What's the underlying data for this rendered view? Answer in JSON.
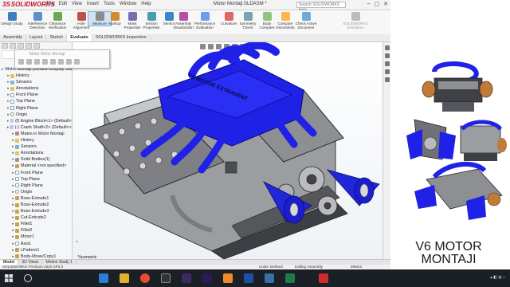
{
  "app": {
    "logo_text": "SOLIDWORKS",
    "menu": [
      "File",
      "Edit",
      "View",
      "Insert",
      "Tools",
      "Window",
      "Help"
    ],
    "document_title": "Motor Montaji.SLDASM *",
    "search_placeholder": "Search SOLIDWORKS Help"
  },
  "commands": [
    {
      "label": "Design Study",
      "color": "#3b7dc0"
    },
    {
      "label": "Interference Detection",
      "color": "#5d8fc9"
    },
    {
      "label": "Clearance Verification",
      "color": "#6aa84f"
    },
    {
      "label": "Hole Alignment",
      "color": "#c0504d"
    },
    {
      "label": "Measure",
      "color": "#8c8c8c",
      "active": true
    },
    {
      "label": "Markup",
      "color": "#d08b2b"
    },
    {
      "label": "Mass Properties",
      "color": "#7c6ab2"
    },
    {
      "label": "Section Properties",
      "color": "#4b9cb3"
    },
    {
      "label": "Sensor",
      "color": "#3d85c6"
    },
    {
      "label": "Assembly Visualization",
      "color": "#b04fa8"
    },
    {
      "label": "Performance Evaluation",
      "color": "#6d9eeb"
    },
    {
      "label": "Curvature",
      "color": "#e06666"
    },
    {
      "label": "Symmetry Check",
      "color": "#76a5af"
    },
    {
      "label": "Body Compare",
      "color": "#93c47d"
    },
    {
      "label": "Compare Documents",
      "color": "#ffb74d"
    },
    {
      "label": "Check Active Document",
      "color": "#6fa8dc"
    },
    {
      "label": "SOLIDWORKS Simulation",
      "color": "#bbbbbb",
      "dim": true
    }
  ],
  "tabs": [
    "Assembly",
    "Layout",
    "Sketch",
    "Evaluate",
    "SOLIDWORKS Inspection"
  ],
  "active_tab": "Evaluate",
  "tree": [
    {
      "label": "Motor Montaji (Default<Display State-1>)",
      "depth": 0,
      "icon": "part"
    },
    {
      "label": "History",
      "depth": 1,
      "icon": "folder"
    },
    {
      "label": "Sensors",
      "depth": 1,
      "icon": "sensor"
    },
    {
      "label": "Annotations",
      "depth": 1,
      "icon": "folder"
    },
    {
      "label": "Front Plane",
      "depth": 1,
      "icon": "plane"
    },
    {
      "label": "Top Plane",
      "depth": 1,
      "icon": "plane"
    },
    {
      "label": "Right Plane",
      "depth": 1,
      "icon": "plane"
    },
    {
      "label": "Origin",
      "depth": 1,
      "icon": "origin"
    },
    {
      "label": "(f) Engine Block<1> (Default<",
      "depth": 1,
      "icon": "part"
    },
    {
      "label": "(-) Crank Shaft<2> (Default<<",
      "depth": 1,
      "icon": "part"
    },
    {
      "label": "Mates in Motor Montaji",
      "depth": 2,
      "icon": "mate"
    },
    {
      "label": "History",
      "depth": 2,
      "icon": "folder"
    },
    {
      "label": "Sensors",
      "depth": 2,
      "icon": "sensor"
    },
    {
      "label": "Annotations",
      "depth": 2,
      "icon": "folder"
    },
    {
      "label": "Solid Bodies(1)",
      "depth": 2,
      "icon": "body"
    },
    {
      "label": "Material <not specified>",
      "depth": 2,
      "icon": "feat"
    },
    {
      "label": "Front Plane",
      "depth": 2,
      "icon": "plane"
    },
    {
      "label": "Top Plane",
      "depth": 2,
      "icon": "plane"
    },
    {
      "label": "Right Plane",
      "depth": 2,
      "icon": "plane"
    },
    {
      "label": "Origin",
      "depth": 2,
      "icon": "origin"
    },
    {
      "label": "Boss-Extrude1",
      "depth": 2,
      "icon": "feat"
    },
    {
      "label": "Boss-Extrude2",
      "depth": 2,
      "icon": "feat"
    },
    {
      "label": "Boss-Extrude3",
      "depth": 2,
      "icon": "feat"
    },
    {
      "label": "Cut-Extrude2",
      "depth": 2,
      "icon": "feat"
    },
    {
      "label": "Fillet1",
      "depth": 2,
      "icon": "feat"
    },
    {
      "label": "Fillet2",
      "depth": 2,
      "icon": "feat"
    },
    {
      "label": "Mirror1",
      "depth": 2,
      "icon": "feat"
    },
    {
      "label": "Axis1",
      "depth": 2,
      "icon": "plane"
    },
    {
      "label": "LPattern1",
      "depth": 2,
      "icon": "feat"
    },
    {
      "label": "Body-Move/Copy1",
      "depth": 2,
      "icon": "feat"
    }
  ],
  "mini_toolbar_title": "Motor  Motor Montaji",
  "view_label": "*Isometric",
  "model_tabs": [
    "Model",
    "3D Views",
    "Motion Study 1"
  ],
  "status": {
    "left": "SOLIDWORKS Premium 2020 SP0.0",
    "middle1": "Under Defined",
    "middle2": "Editing Assembly",
    "units": "MMGS"
  },
  "manifold_text": "V6 MOTOR EXTRAVENT",
  "promo_title": "V6 MOTOR MONTAJI",
  "colors": {
    "accent_blue": "#1f22e6",
    "metal": "#8d8f93",
    "dark_metal": "#3d3f44",
    "copper": "#c07a3a"
  }
}
